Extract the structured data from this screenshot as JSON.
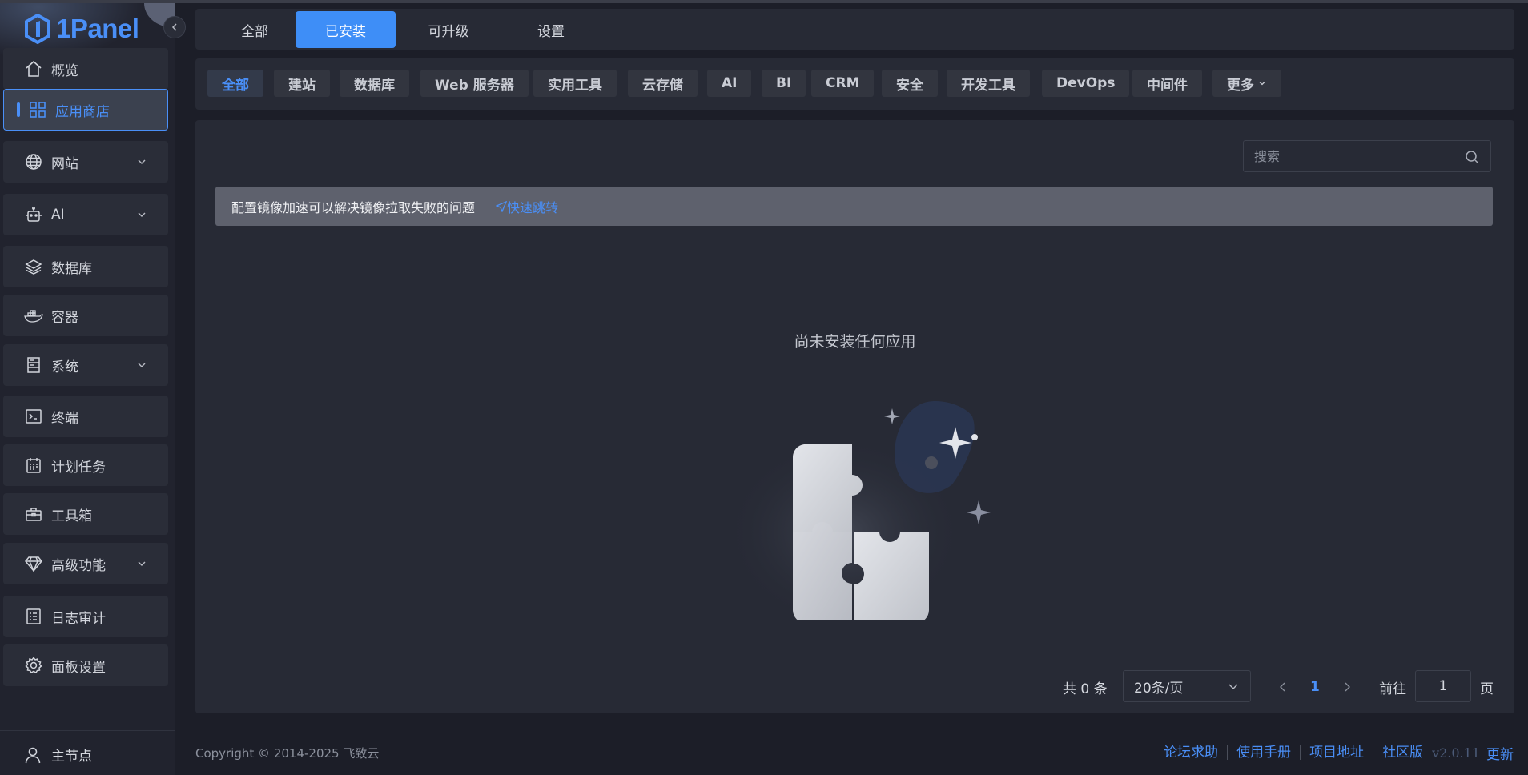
{
  "app": {
    "logo_text": "1Panel"
  },
  "sidebar": {
    "items": [
      {
        "label": "概览",
        "icon": "home-icon"
      },
      {
        "label": "应用商店",
        "icon": "apps-grid-icon",
        "active": true
      },
      {
        "label": "网站",
        "icon": "globe-icon",
        "expandable": true
      },
      {
        "label": "AI",
        "icon": "robot-icon",
        "expandable": true
      },
      {
        "label": "数据库",
        "icon": "layers-icon"
      },
      {
        "label": "容器",
        "icon": "docker-icon"
      },
      {
        "label": "系统",
        "icon": "server-icon",
        "expandable": true
      },
      {
        "label": "终端",
        "icon": "terminal-icon"
      },
      {
        "label": "计划任务",
        "icon": "calendar-icon"
      },
      {
        "label": "工具箱",
        "icon": "toolbox-icon"
      },
      {
        "label": "高级功能",
        "icon": "diamond-icon",
        "expandable": true
      },
      {
        "label": "日志审计",
        "icon": "log-icon"
      },
      {
        "label": "面板设置",
        "icon": "gear-icon"
      }
    ],
    "node": {
      "label": "主节点",
      "icon": "user-icon"
    }
  },
  "tabs": [
    {
      "label": "全部"
    },
    {
      "label": "已安装",
      "active": true
    },
    {
      "label": "可升级"
    },
    {
      "label": "设置"
    }
  ],
  "categories": [
    {
      "label": "全部",
      "active": true
    },
    {
      "label": "建站"
    },
    {
      "label": "数据库"
    },
    {
      "label": "Web 服务器"
    },
    {
      "label": "实用工具"
    },
    {
      "label": "云存储"
    },
    {
      "label": "AI"
    },
    {
      "label": "BI"
    },
    {
      "label": "CRM"
    },
    {
      "label": "安全"
    },
    {
      "label": "开发工具"
    },
    {
      "label": "DevOps"
    },
    {
      "label": "中间件"
    },
    {
      "label": "更多"
    }
  ],
  "search": {
    "placeholder": "搜索"
  },
  "notice": {
    "text": "配置镜像加速可以解决镜像拉取失败的问题",
    "link": "快速跳转"
  },
  "empty": {
    "text": "尚未安装任何应用"
  },
  "pagination": {
    "total": "共 0 条",
    "page_size": "20条/页",
    "current_page": "1",
    "goto_label": "前往",
    "goto_value": "1",
    "page_suffix": "页"
  },
  "footer": {
    "copyright": "Copyright © 2014-2025 飞致云",
    "links": [
      "论坛求助",
      "使用手册",
      "项目地址",
      "社区版"
    ],
    "version": "v2.0.11",
    "update": "更新"
  },
  "colors": {
    "accent": "#4a8ff7",
    "tab_active_bg": "#3e8ef7",
    "page_bg": "#1c1e28",
    "panel_bg": "#272a35"
  }
}
